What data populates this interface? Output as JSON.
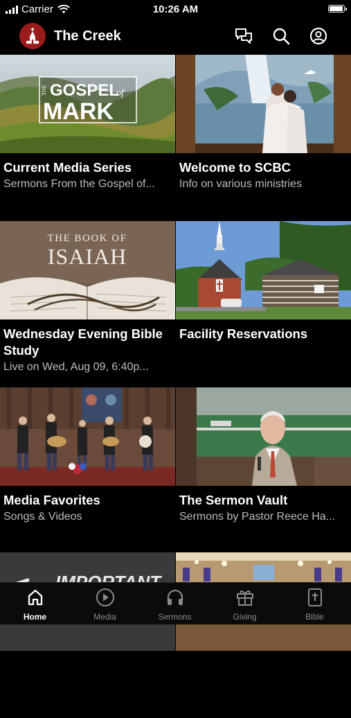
{
  "status_bar": {
    "carrier": "Carrier",
    "time": "10:26 AM",
    "battery_level": 1.0
  },
  "header": {
    "title": "The Creek",
    "icons": [
      "chat-icon",
      "search-icon",
      "account-icon"
    ]
  },
  "tiles": [
    {
      "thumb_text_1": "THE",
      "thumb_text_2": "GOSPEL",
      "thumb_text_3": "of",
      "thumb_text_4": "MARK",
      "title": "Current Media Series",
      "subtitle": "Sermons From the Gospel of..."
    },
    {
      "title": "Welcome to SCBC",
      "subtitle": "Info on various ministries"
    },
    {
      "thumb_text_1": "THE BOOK OF",
      "thumb_text_2": "ISAIAH",
      "title": "Wednesday Evening Bible Study",
      "subtitle": "Live on Wed, Aug 09, 6:40p..."
    },
    {
      "title": "Facility Reservations",
      "subtitle": ""
    },
    {
      "title": "Media Favorites",
      "subtitle": "Songs & Videos"
    },
    {
      "title": "The Sermon Vault",
      "subtitle": "Sermons by Pastor Reece Ha..."
    },
    {
      "thumb_text_1": "IMPORTANT"
    },
    {}
  ],
  "tab_bar": {
    "items": [
      {
        "label": "Home",
        "icon": "home-icon",
        "active": true
      },
      {
        "label": "Media",
        "icon": "play-icon",
        "active": false
      },
      {
        "label": "Sermons",
        "icon": "headphones-icon",
        "active": false
      },
      {
        "label": "Giving",
        "icon": "gift-icon",
        "active": false
      },
      {
        "label": "Bible",
        "icon": "bible-icon",
        "active": false
      }
    ]
  },
  "colors": {
    "background": "#000000",
    "brand": "#9b1c1c",
    "subtitle": "#bdbdbd",
    "tab_inactive": "#8a8a8a"
  }
}
